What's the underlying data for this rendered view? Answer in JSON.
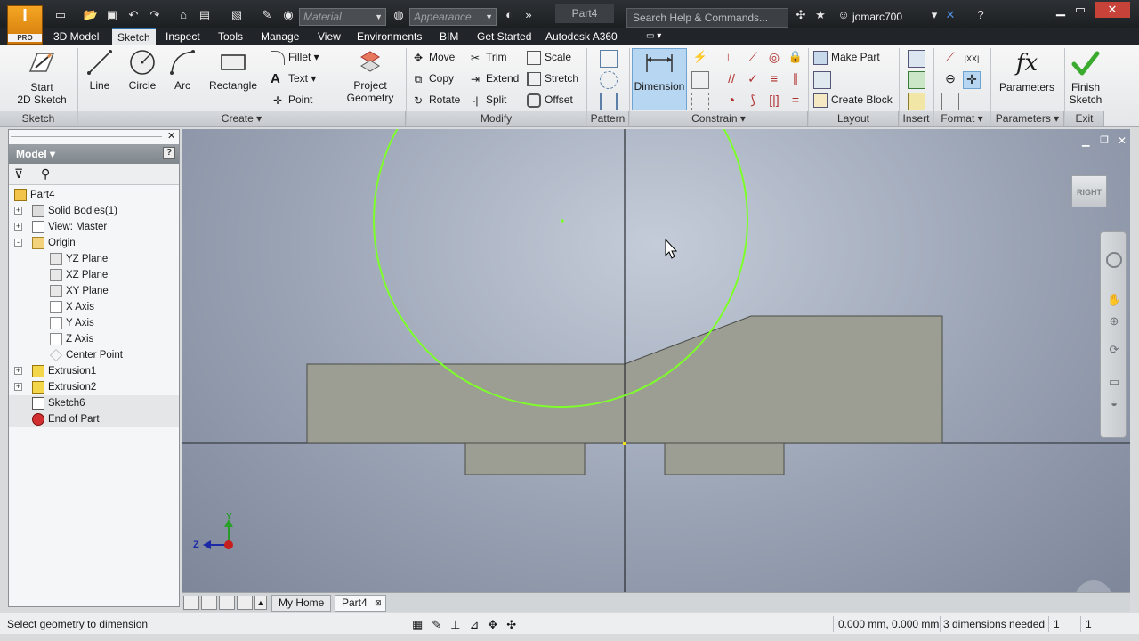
{
  "titlebar": {
    "logo_letter": "I",
    "logo_badge": "PRO",
    "material_placeholder": "Material",
    "appearance_placeholder": "Appearance",
    "document_title": "Part4",
    "search_placeholder": "Search Help & Commands...",
    "user_name": "jomarc700"
  },
  "menu": {
    "items": [
      "3D Model",
      "Sketch",
      "Inspect",
      "Tools",
      "Manage",
      "View",
      "Environments",
      "BIM",
      "Get Started",
      "Autodesk A360"
    ],
    "active": "Sketch"
  },
  "ribbon": {
    "sketch_panel": {
      "start_label_1": "Start",
      "start_label_2": "2D Sketch",
      "footer": "Sketch"
    },
    "create_panel": {
      "line": "Line",
      "circle": "Circle",
      "arc": "Arc",
      "rectangle": "Rectangle",
      "fillet": "Fillet",
      "text": "Text",
      "point": "Point",
      "project_1": "Project",
      "project_2": "Geometry",
      "footer": "Create"
    },
    "modify_panel": {
      "move": "Move",
      "copy": "Copy",
      "rotate": "Rotate",
      "trim": "Trim",
      "extend": "Extend",
      "split": "Split",
      "scale": "Scale",
      "stretch": "Stretch",
      "offset": "Offset",
      "footer": "Modify"
    },
    "pattern_panel": {
      "footer": "Pattern"
    },
    "constrain_panel": {
      "dimension": "Dimension",
      "footer": "Constrain"
    },
    "layout_panel": {
      "make_part": "Make Part",
      "create_block": "Create Block",
      "footer": "Layout"
    },
    "insert_panel": {
      "footer": "Insert"
    },
    "format_panel": {
      "footer": "Format"
    },
    "parameters_panel": {
      "label": "Parameters",
      "glyph": "fx",
      "footer": "Parameters"
    },
    "exit_panel": {
      "finish_1": "Finish",
      "finish_2": "Sketch",
      "footer": "Exit"
    }
  },
  "browser": {
    "title": "Model",
    "tree": [
      {
        "label": "Part4",
        "level": 0,
        "expander": "",
        "icon": "part-icon"
      },
      {
        "label": "Solid Bodies(1)",
        "level": 1,
        "expander": "+",
        "icon": "solid-bodies-icon"
      },
      {
        "label": "View: Master",
        "level": 1,
        "expander": "+",
        "icon": "view-icon"
      },
      {
        "label": "Origin",
        "level": 1,
        "expander": "-",
        "icon": "folder-icon"
      },
      {
        "label": "YZ Plane",
        "level": 2,
        "expander": "",
        "icon": "plane-icon"
      },
      {
        "label": "XZ Plane",
        "level": 2,
        "expander": "",
        "icon": "plane-icon"
      },
      {
        "label": "XY Plane",
        "level": 2,
        "expander": "",
        "icon": "plane-icon"
      },
      {
        "label": "X Axis",
        "level": 2,
        "expander": "",
        "icon": "axis-icon"
      },
      {
        "label": "Y Axis",
        "level": 2,
        "expander": "",
        "icon": "axis-icon"
      },
      {
        "label": "Z Axis",
        "level": 2,
        "expander": "",
        "icon": "axis-icon"
      },
      {
        "label": "Center Point",
        "level": 2,
        "expander": "",
        "icon": "point-icon"
      },
      {
        "label": "Extrusion1",
        "level": 1,
        "expander": "+",
        "icon": "extrusion-icon"
      },
      {
        "label": "Extrusion2",
        "level": 1,
        "expander": "+",
        "icon": "extrusion-icon"
      },
      {
        "label": "Sketch6",
        "level": 1,
        "expander": "",
        "icon": "sketch-icon"
      },
      {
        "label": "End of Part",
        "level": 1,
        "expander": "",
        "icon": "end-of-part-icon"
      }
    ]
  },
  "viewport": {
    "viewcube_label": "RIGHT",
    "triad_y": "Y",
    "triad_z": "Z"
  },
  "doctabs": {
    "home": "My Home",
    "part": "Part4"
  },
  "status": {
    "prompt": "Select geometry to dimension",
    "coordinates": "0.000 mm, 0.000 mm",
    "dimensions_needed": "3 dimensions needed",
    "count_1": "1",
    "count_2": "1"
  },
  "colors": {
    "ribbon_active": "#b7d6f1",
    "sketch_green": "#7dff2a",
    "part_fill": "#9d9e93"
  }
}
